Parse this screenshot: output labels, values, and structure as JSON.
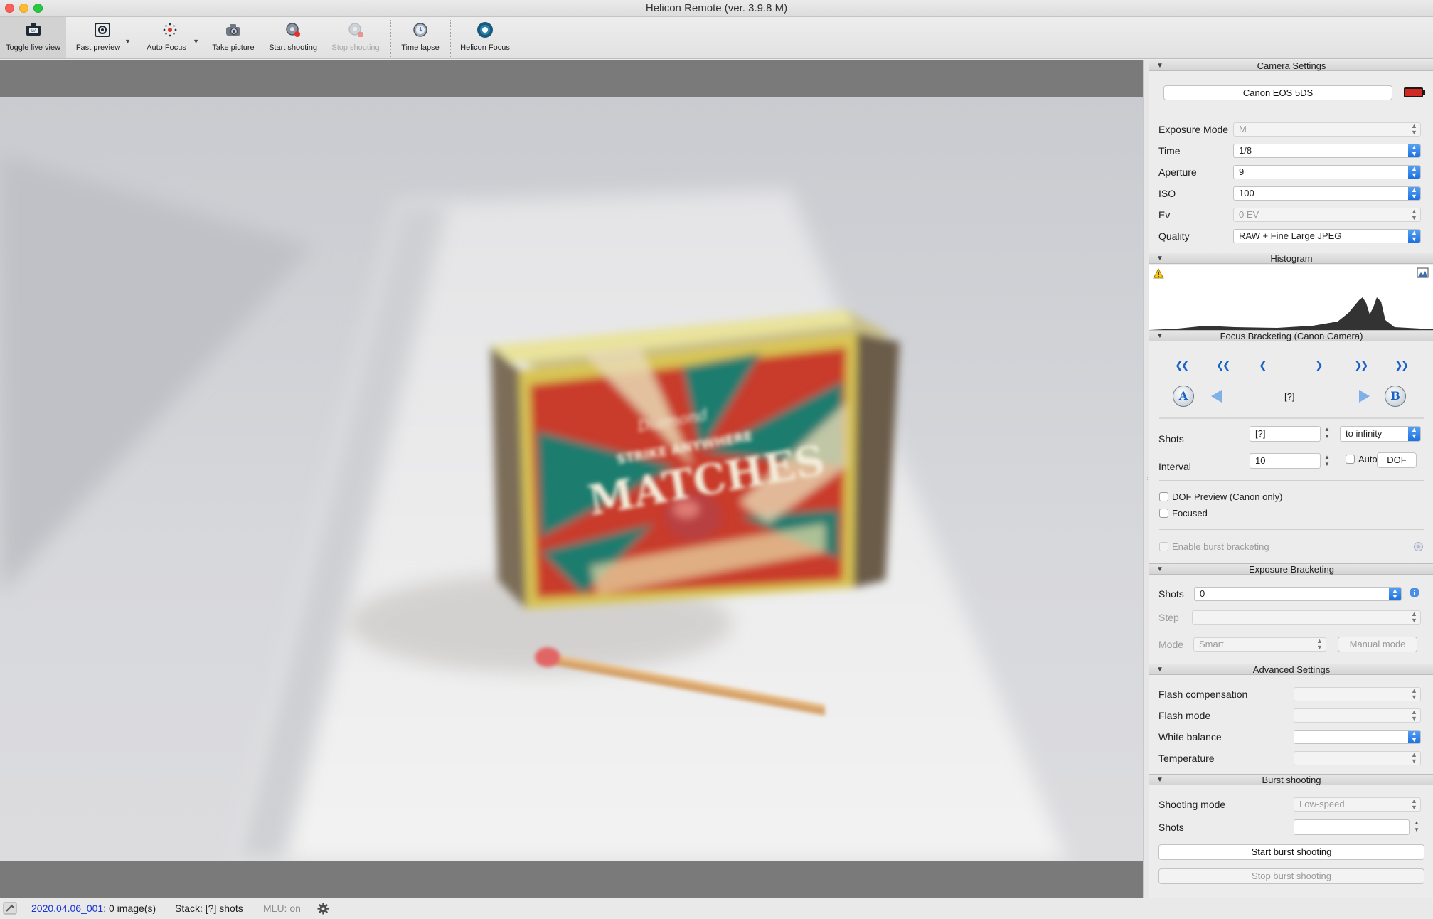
{
  "window": {
    "title": "Helicon Remote (ver. 3.9.8 M)"
  },
  "toolbar": {
    "toggle_live_view": "Toggle live view",
    "fast_preview": "Fast preview",
    "auto_focus": "Auto Focus",
    "take_picture": "Take picture",
    "start_shooting": "Start shooting",
    "stop_shooting": "Stop shooting",
    "time_lapse": "Time lapse",
    "helicon_focus": "Helicon Focus"
  },
  "camera_settings": {
    "header": "Camera Settings",
    "camera_name": "Canon EOS 5DS",
    "exposure_mode_label": "Exposure Mode",
    "exposure_mode_value": "M",
    "time_label": "Time",
    "time_value": "1/8",
    "aperture_label": "Aperture",
    "aperture_value": "9",
    "iso_label": "ISO",
    "iso_value": "100",
    "ev_label": "Ev",
    "ev_value": "0 EV",
    "quality_label": "Quality",
    "quality_value": "RAW + Fine Large JPEG"
  },
  "histogram": {
    "header": "Histogram"
  },
  "focus_bracketing": {
    "header": "Focus Bracketing (Canon Camera)",
    "position_value": "[?]",
    "point_a": "A",
    "point_b": "B",
    "shots_label": "Shots",
    "shots_value": "[?]",
    "range_value": "to infinity",
    "interval_label": "Interval",
    "interval_value": "10",
    "auto_label": "Auto",
    "dof_button": "DOF",
    "dof_preview_label": "DOF Preview (Canon only)",
    "focused_label": "Focused",
    "burst_bracketing_label": "Enable burst bracketing"
  },
  "exposure_bracketing": {
    "header": "Exposure Bracketing",
    "shots_label": "Shots",
    "shots_value": "0",
    "step_label": "Step",
    "step_value": "",
    "mode_label": "Mode",
    "mode_value": "Smart",
    "manual_mode_button": "Manual mode"
  },
  "advanced_settings": {
    "header": "Advanced Settings",
    "flash_compensation_label": "Flash compensation",
    "flash_mode_label": "Flash mode",
    "white_balance_label": "White balance",
    "temperature_label": "Temperature"
  },
  "burst_shooting": {
    "header": "Burst shooting",
    "shooting_mode_label": "Shooting mode",
    "shooting_mode_value": "Low-speed",
    "shots_label": "Shots",
    "shots_value": "",
    "start_button": "Start burst shooting",
    "stop_button": "Stop burst shooting"
  },
  "status_bar": {
    "folder_link": "2020.04.06_001",
    "images_count": ": 0 image(s)",
    "stack": "Stack: [?] shots",
    "mlu": "MLU: on"
  },
  "colors": {
    "accent_blue": "#1a6fe0",
    "link_blue": "#1733d6",
    "nav_blue": "#1a62c4"
  }
}
